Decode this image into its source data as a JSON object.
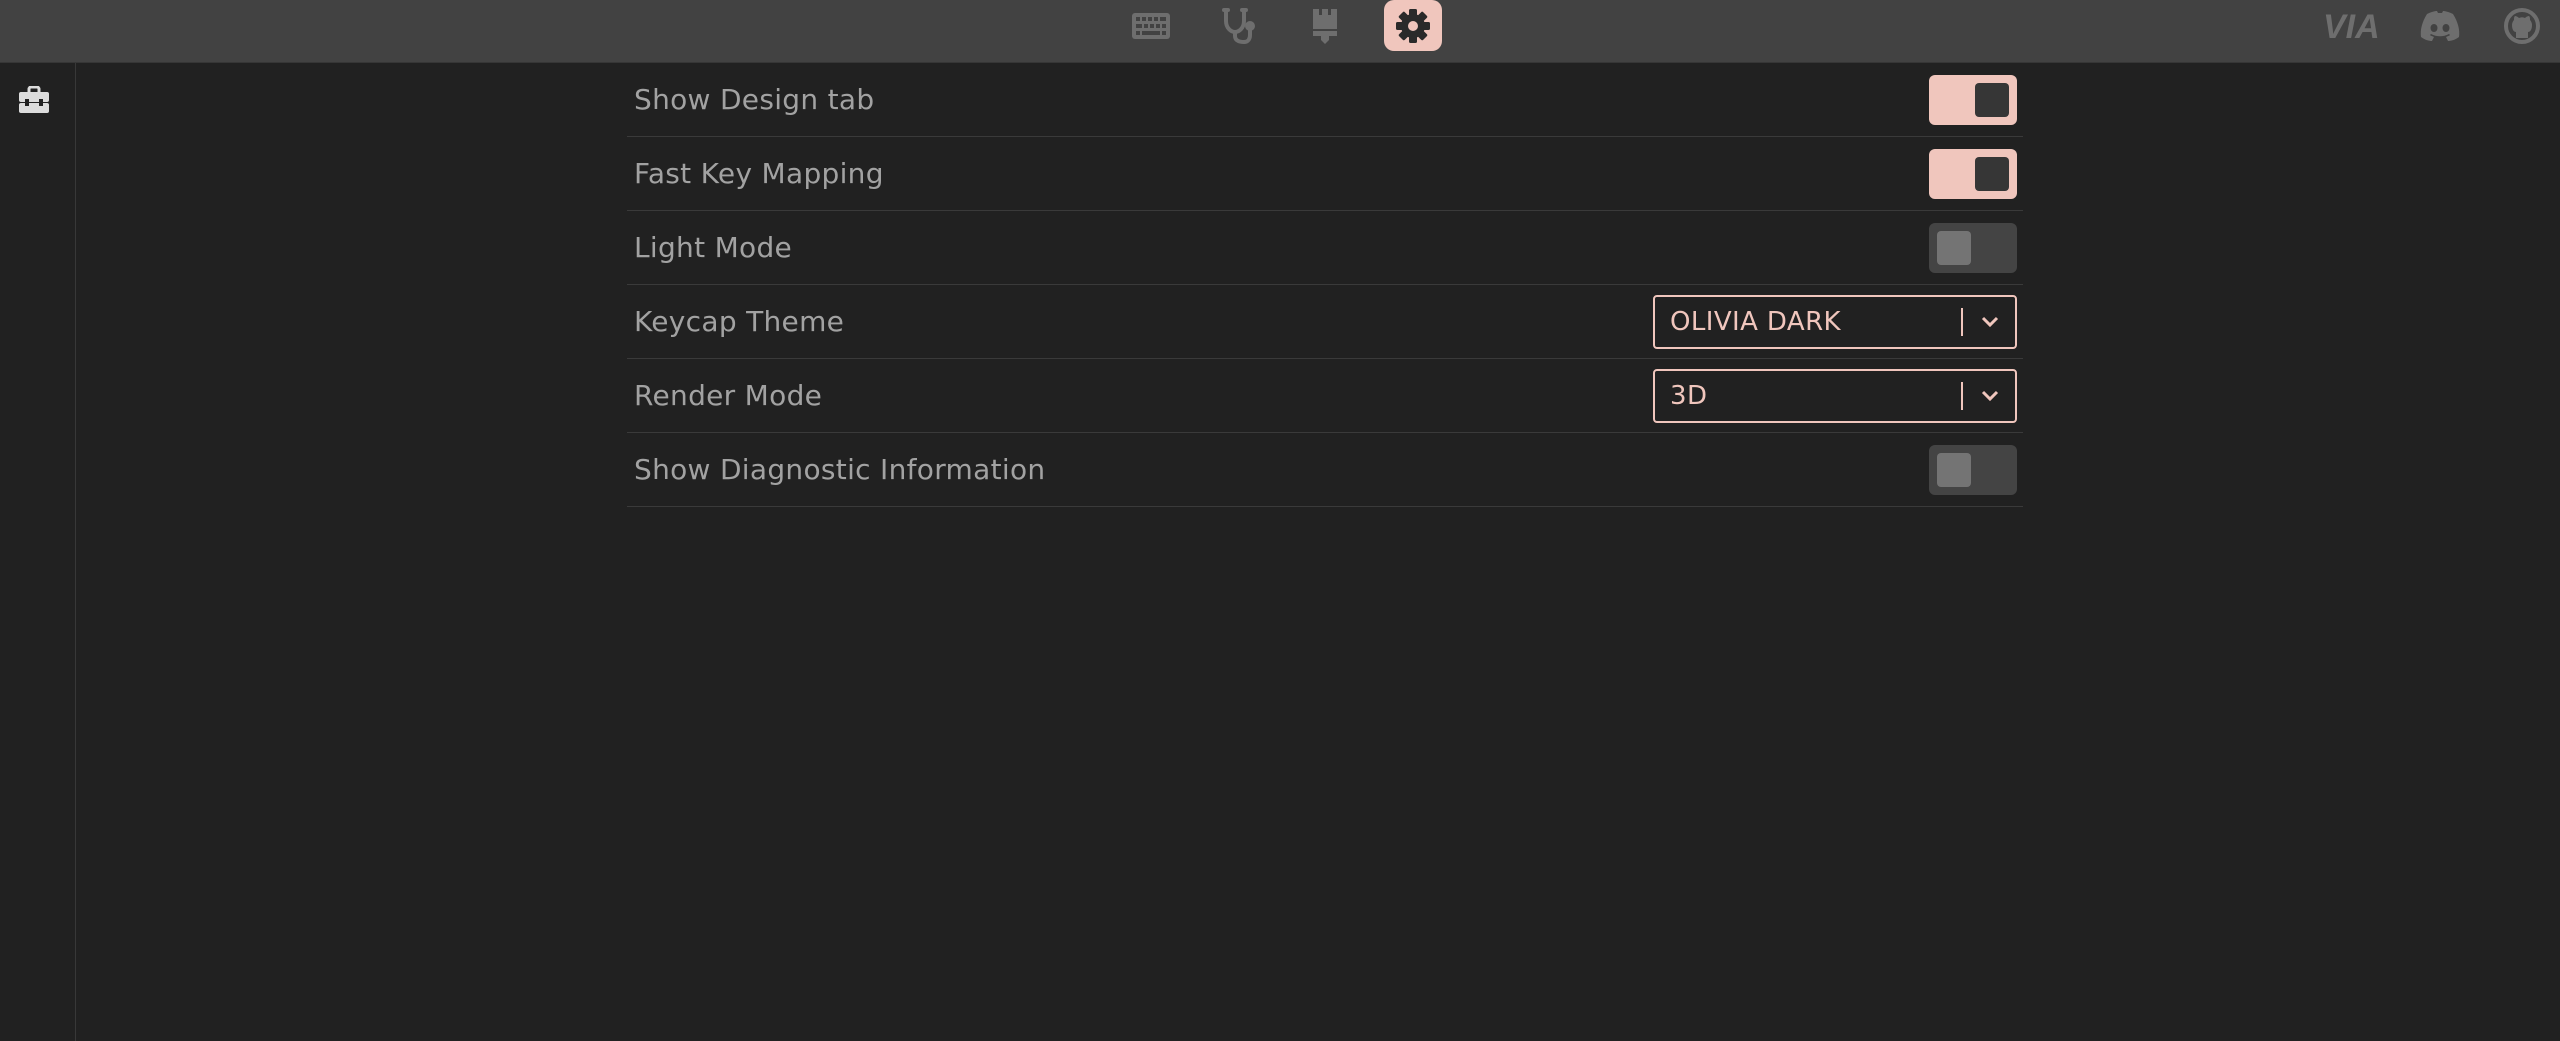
{
  "topbar": {
    "nav_icons": [
      {
        "name": "keyboard-icon",
        "active": false
      },
      {
        "name": "stethoscope-icon",
        "active": false
      },
      {
        "name": "paintbrush-icon",
        "active": false
      },
      {
        "name": "gear-icon",
        "active": true
      }
    ],
    "right_icons": [
      "via-logo",
      "discord-icon",
      "github-icon"
    ],
    "via_logo_text": "VIA"
  },
  "sidebar": {
    "items": [
      {
        "name": "toolbox-icon"
      }
    ]
  },
  "settings": {
    "rows": [
      {
        "label": "Show Design tab",
        "control": "toggle",
        "checked": true
      },
      {
        "label": "Fast Key Mapping",
        "control": "toggle",
        "checked": true
      },
      {
        "label": "Light Mode",
        "control": "toggle",
        "checked": false
      },
      {
        "label": "Keycap Theme",
        "control": "select",
        "value": "OLIVIA DARK"
      },
      {
        "label": "Render Mode",
        "control": "select",
        "value": "3D"
      },
      {
        "label": "Show Diagnostic Information",
        "control": "toggle",
        "checked": false
      }
    ]
  },
  "colors": {
    "accent": "#f0c6bd",
    "background": "#212121",
    "topbar": "#424242",
    "icon_muted": "#6e6e6e",
    "label_text": "#a2a2a2"
  }
}
